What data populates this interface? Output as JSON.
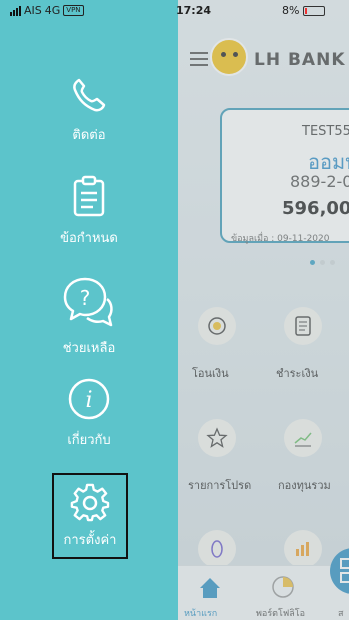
{
  "status_bar": {
    "carrier": "AIS",
    "network": "4G",
    "vpn": "VPN",
    "time": "17:24",
    "battery": "8%"
  },
  "drawer": {
    "items": [
      {
        "label": "ติดต่อ",
        "icon": "phone-icon"
      },
      {
        "label": "ข้อกำหนด",
        "icon": "clipboard-icon"
      },
      {
        "label": "ช่วยเหลือ",
        "icon": "help-chat-icon"
      },
      {
        "label": "เกี่ยวกับ",
        "icon": "info-icon"
      },
      {
        "label": "การตั้งค่า",
        "icon": "gear-icon",
        "selected": true
      }
    ]
  },
  "main": {
    "bank_name": "LH BANK",
    "account": {
      "name": "TEST55",
      "type": "ออมท",
      "number": "889-2-0",
      "balance": "596,00"
    },
    "data_as_of": "ข้อมูลเมื่อ : 09-11-2020",
    "quick_actions": [
      {
        "label": "โอนเงิน",
        "icon": "transfer-icon"
      },
      {
        "label": "ชำระเงิน",
        "icon": "bill-icon"
      },
      {
        "label": "รายการโปรด",
        "icon": "star-icon"
      },
      {
        "label": "กองทุนรวม",
        "icon": "fund-chart-icon"
      }
    ],
    "bottom_nav": [
      {
        "label": "หน้าแรก",
        "icon": "home-icon"
      },
      {
        "label": "พอร์ตโฟลิโอ",
        "icon": "portfolio-pie-icon"
      },
      {
        "label": "ส",
        "icon": "scan-icon"
      }
    ]
  },
  "colors": {
    "drawer_bg": "#5cc4cb",
    "accent": "#2d8fc4"
  }
}
